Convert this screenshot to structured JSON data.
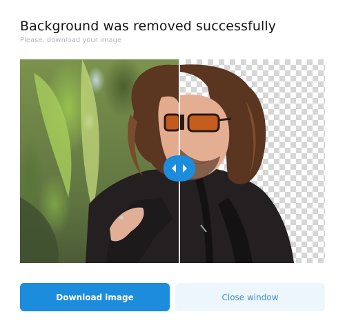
{
  "dialog": {
    "title": "Background was removed successfully",
    "subtitle": "Please, download your image"
  },
  "preview": {
    "left_label": "original image",
    "right_label": "background removed image",
    "handle_icon": "left-right-arrows-icon",
    "checker_color": "#d6d6d6"
  },
  "actions": {
    "download_label": "Download image",
    "close_label": "Close window"
  },
  "colors": {
    "primary": "#1c8cdc",
    "secondary_bg": "#eef6fd",
    "secondary_text": "#3b8fd0"
  }
}
